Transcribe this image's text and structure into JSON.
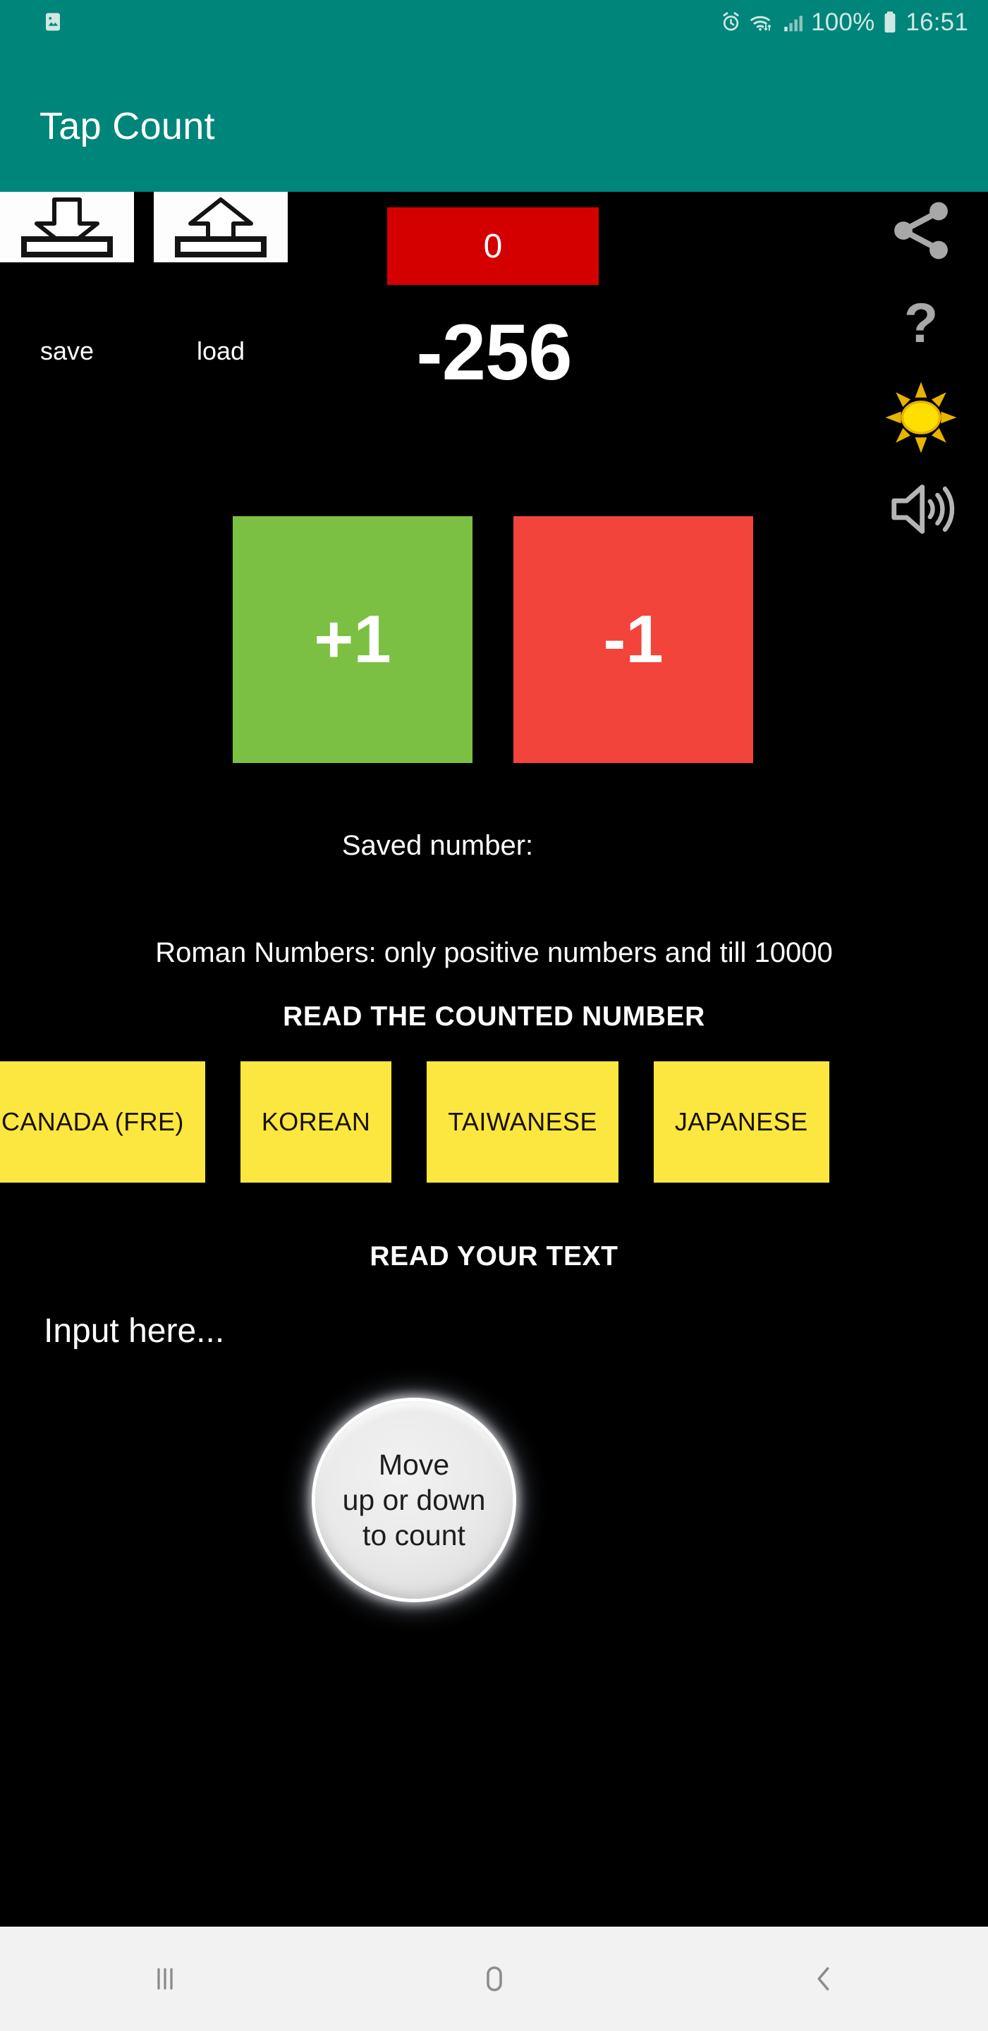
{
  "status_bar": {
    "gallery_icon": "image-icon",
    "alarm_icon": "alarm-icon",
    "wifi_icon": "wifi-icon",
    "signal_icon": "signal-bars-icon",
    "battery_percent": "100%",
    "battery_icon": "battery-icon",
    "time": "16:51"
  },
  "app_bar": {
    "title": "Tap Count",
    "background": "#00857a"
  },
  "controls": {
    "save_label": "save",
    "save_icon": "download-tray-icon",
    "load_label": "load",
    "load_icon": "upload-tray-icon",
    "reset_value": "0",
    "reset_color": "#d40000",
    "counter_value": "-256",
    "increment_label": "+1",
    "increment_color": "#7cc043",
    "decrement_label": "-1",
    "decrement_color": "#f2443a"
  },
  "rail": {
    "share_icon": "share-icon",
    "help_icon": "question-mark-icon",
    "theme_icon": "sun-icon",
    "sound_icon": "speaker-volume-icon"
  },
  "info": {
    "saved_number_label": "Saved number:",
    "roman_note": "Roman Numbers: only positive numbers and till 10000"
  },
  "sections": {
    "read_counted_number": "READ THE COUNTED NUMBER",
    "read_your_text": "READ YOUR TEXT"
  },
  "languages": {
    "accent": "#fbe73f",
    "items": [
      {
        "label": "CANADA (FRE)"
      },
      {
        "label": "KOREAN"
      },
      {
        "label": "TAIWANESE"
      },
      {
        "label": "JAPANESE"
      }
    ]
  },
  "text_input": {
    "value": "",
    "placeholder": "Input here..."
  },
  "round_button": {
    "label": "Move\nup or down\nto count"
  },
  "nav_bar": {
    "recents_icon": "recents-icon",
    "home_icon": "home-icon",
    "back_icon": "back-chevron-icon"
  }
}
